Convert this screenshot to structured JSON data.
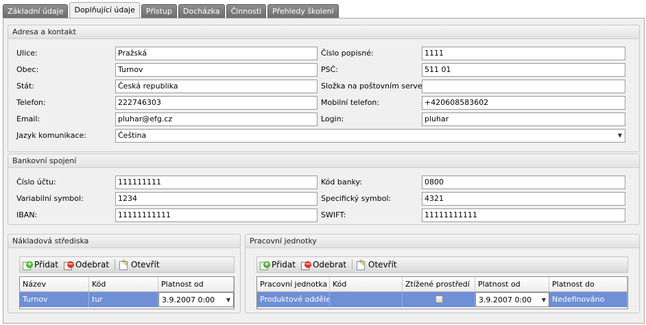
{
  "tabs": [
    "Základní údaje",
    "Doplňující údaje",
    "Přístup",
    "Docházka",
    "Činnosti",
    "Přehledy školení"
  ],
  "active_tab": 1,
  "address": {
    "title": "Adresa a kontakt",
    "street_label": "Ulice:",
    "street": "Pražská",
    "number_label": "Číslo popisné:",
    "number": "1111",
    "city_label": "Obec:",
    "city": "Turnov",
    "zip_label": "PSČ:",
    "zip": "511 01",
    "country_label": "Stát:",
    "country": "Česká republika",
    "folder_label": "Složka na poštovním serveru:",
    "folder": "",
    "phone_label": "Telefon:",
    "phone": "222746303",
    "mobile_label": "Mobilní telefon:",
    "mobile": "+420608583602",
    "email_label": "Email:",
    "email": "pluhar@efg.cz",
    "login_label": "Login:",
    "login": "pluhar",
    "language_label": "Jazyk komunikace:",
    "language": "Čeština"
  },
  "bank": {
    "title": "Bankovní spojení",
    "account_label": "Číslo účtu:",
    "account": "111111111",
    "bankcode_label": "Kód banky:",
    "bankcode": "0800",
    "variable_label": "Variabilní symbol:",
    "variable": "1234",
    "specific_label": "Specifický symbol:",
    "specific": "4321",
    "iban_label": "IBAN:",
    "iban": "11111111111",
    "swift_label": "SWIFT:",
    "swift": "11111111111"
  },
  "toolbar": {
    "add": "Přidat",
    "remove": "Odebrat",
    "open": "Otevřít"
  },
  "cost_centers": {
    "title": "Nákladová střediska",
    "columns": [
      "Název",
      "Kód",
      "Platnost od"
    ],
    "rows": [
      [
        "Turnov",
        "tur",
        "3.9.2007 0:00"
      ]
    ]
  },
  "work_units": {
    "title": "Pracovní jednotky",
    "columns": [
      "Pracovní jednotka",
      "Kód",
      "Ztížené prostředí",
      "Platnost od",
      "Platnost do"
    ],
    "rows": [
      [
        "Produktové oddělení",
        "",
        "",
        "3.9.2007 0:00",
        "Nedefinováno"
      ]
    ]
  },
  "icons": {
    "dropdown": "chevron-down-icon",
    "add": "add-icon",
    "remove": "remove-icon",
    "open": "edit-icon"
  }
}
